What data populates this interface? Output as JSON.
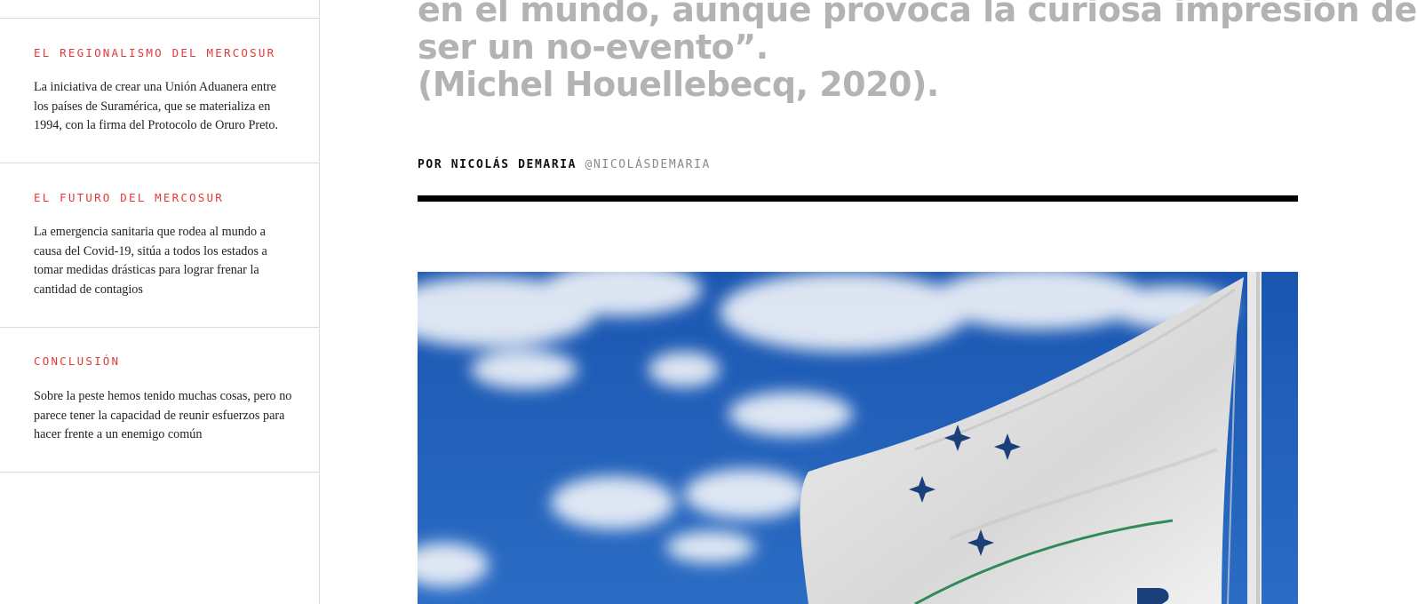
{
  "sidebar": {
    "sections": [
      {
        "title": "EL REGIONALISMO DEL MERCOSUR",
        "description": "La iniciativa de crear una Unión Aduanera entre los países de Suramérica, que se materializa en 1994, con la firma del Protocolo de Oruro Preto."
      },
      {
        "title": "EL FUTURO DEL MERCOSUR",
        "description": "La emergencia sanitaria que rodea al mundo a causa del Covid-19, sitúa a todos los estados a tomar medidas drásticas para lograr frenar la cantidad de contagios"
      },
      {
        "title": "CONCLUSIÓN",
        "description": "Sobre la peste hemos tenido muchas cosas, pero no parece tener la capacidad de reunir esfuerzos para hacer frente a un enemigo común"
      }
    ]
  },
  "article": {
    "quote_lines": [
      "en el mundo, aunque provoca la curiosa impresión de",
      "ser un no-evento”.",
      "(Michel Houellebecq, 2020)."
    ],
    "byline_author": "POR NICOLÁS DEMARIA",
    "byline_handle": "@NICOLÁSDEMARIA"
  },
  "colors": {
    "accent": "#e23a3a",
    "quote_text": "#b3b3b3",
    "sky": "#1f5fb8",
    "flag_star": "#1b3f7a",
    "flag_arc": "#2e8b57"
  },
  "icons": [
    "star-icon"
  ]
}
